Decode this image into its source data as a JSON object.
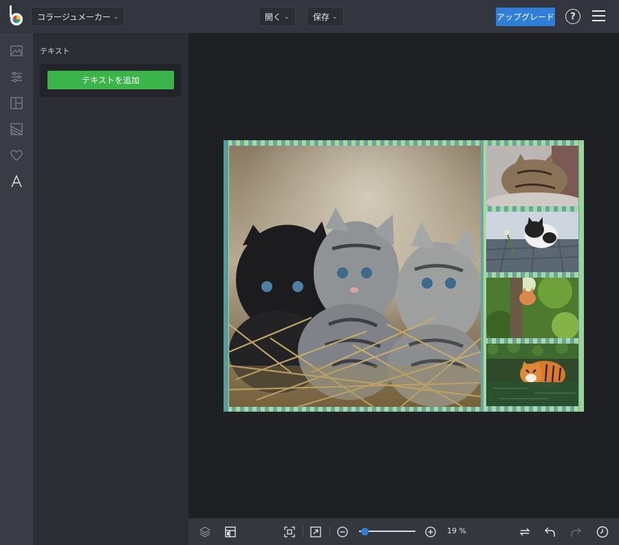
{
  "app": {
    "title_dropdown": "コラージュメーカー",
    "open_label": "開く",
    "save_label": "保存",
    "upgrade_label": "アップグレード",
    "help_label": "?"
  },
  "panel": {
    "title": "テキスト",
    "add_text_label": "テキストを追加"
  },
  "toolbar": {
    "zoom_text": "19 %",
    "zoom_level": 0.19
  },
  "colors": {
    "accent_blue": "#2f7ed8",
    "add_green": "#3bb54a",
    "border_teal": "#6aa6a0",
    "border_green": "#a8d7a1"
  }
}
